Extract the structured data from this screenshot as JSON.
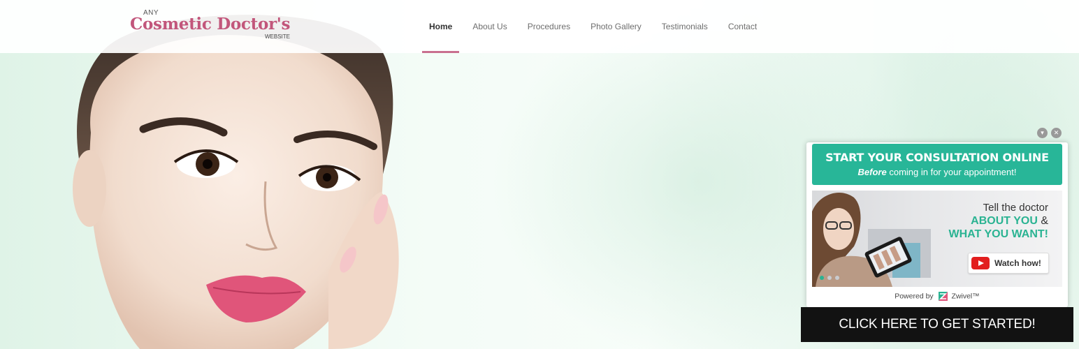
{
  "logo": {
    "top": "ANY",
    "main": "Cosmetic Doctor's",
    "bottom": "WEBSITE"
  },
  "nav": [
    {
      "label": "Home",
      "active": true
    },
    {
      "label": "About Us"
    },
    {
      "label": "Procedures"
    },
    {
      "label": "Photo Gallery"
    },
    {
      "label": "Testimonials"
    },
    {
      "label": "Contact"
    }
  ],
  "widget": {
    "minimize_icon": "▾",
    "close_icon": "✕",
    "title": "START YOUR CONSULTATION ONLINE",
    "subtitle_emphasis": "Before",
    "subtitle_rest": " coming in for your appointment!",
    "tell_line1": "Tell the doctor",
    "tell_about": "ABOUT YOU",
    "tell_amp": " &",
    "tell_want": "WHAT YOU WANT!",
    "watch_label": "Watch how!",
    "powered_by": "Powered by",
    "brand": "Zwivel™",
    "cta": "CLICK HERE TO GET STARTED!"
  },
  "colors": {
    "accent_pink": "#c2567b",
    "accent_teal": "#28b698",
    "cta_bg": "#121212"
  }
}
